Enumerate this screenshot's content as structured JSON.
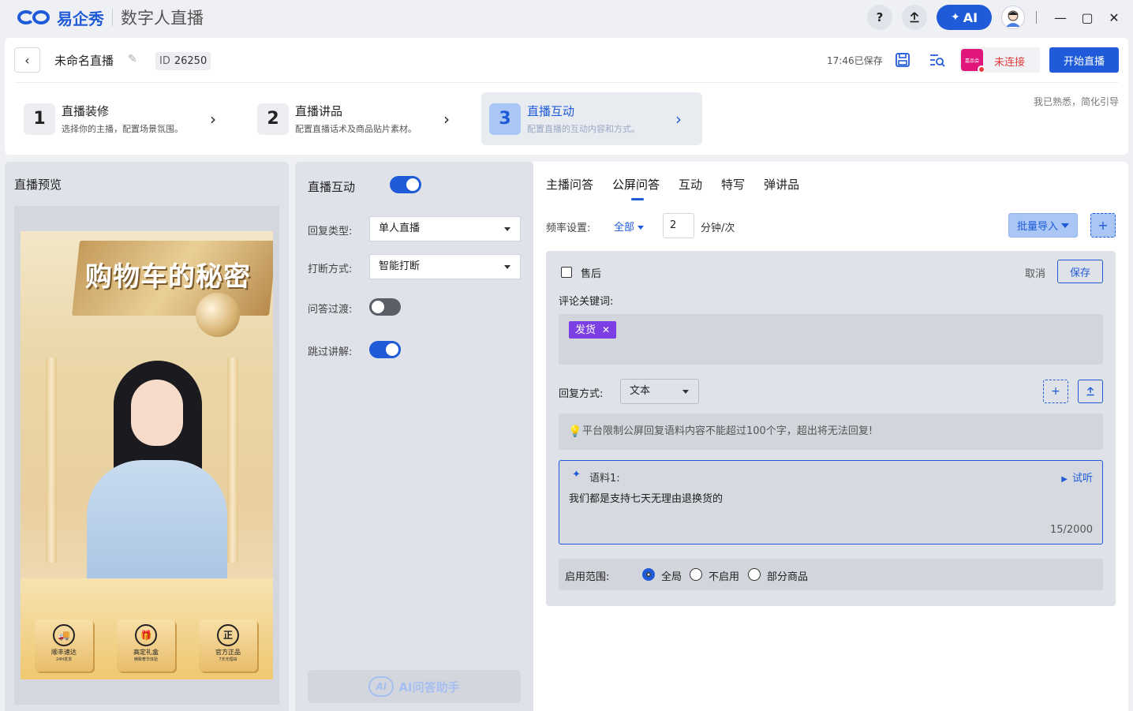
{
  "titlebar": {
    "brand": "易企秀",
    "app_title": "数字人直播",
    "help_label": "?",
    "ai_label": "AI"
  },
  "header": {
    "project_name": "未命名直播",
    "id_prefix": "ID",
    "id_value": "26250",
    "saved_text": "17:46已保存",
    "shop_logo_text": "嘉品会",
    "connect_status": "未连接",
    "start_button": "开始直播"
  },
  "steps": [
    {
      "num": "1",
      "title": "直播装修",
      "desc": "选择你的主播，配置场景氛围。"
    },
    {
      "num": "2",
      "title": "直播讲品",
      "desc": "配置直播话术及商品贴片素材。"
    },
    {
      "num": "3",
      "title": "直播互动",
      "desc": "配置直播的互动内容和方式。"
    }
  ],
  "guide_text": "我已熟悉，简化引导",
  "preview": {
    "title": "直播预览",
    "banner": "购物车的秘密",
    "badges": [
      {
        "icon": "🚚",
        "label": "顺丰速达",
        "sub": "24H发货"
      },
      {
        "icon": "🎁",
        "label": "高定礼盒",
        "sub": "精致奢华体验"
      },
      {
        "icon": "正",
        "label": "官方正品",
        "sub": "7天无理由"
      }
    ]
  },
  "settings": {
    "title": "直播互动",
    "enabled": true,
    "reply_type_label": "回复类型:",
    "reply_type_value": "单人直播",
    "interrupt_label": "打断方式:",
    "interrupt_value": "智能打断",
    "transition_label": "问答过渡:",
    "transition_on": false,
    "skip_label": "跳过讲解:",
    "skip_on": true,
    "ai_assist_label": "AI问答助手",
    "ai_logo": "AI"
  },
  "main": {
    "tabs": [
      "主播问答",
      "公屏问答",
      "互动",
      "特写",
      "弹讲品"
    ],
    "active_tab": "公屏问答",
    "freq_label": "频率设置:",
    "freq_scope": "全部",
    "freq_value": "2",
    "freq_unit": "分钟/次",
    "batch_import": "批量导入",
    "qa": {
      "title": "售后",
      "cancel": "取消",
      "save": "保存",
      "keyword_label": "评论关键词:",
      "keywords": [
        "发货"
      ],
      "reply_method_label": "回复方式:",
      "reply_method_value": "文本",
      "tip": "平台限制公屏回复语料内容不能超过100个字，超出将无法回复!",
      "corpus_label": "语料1:",
      "try_label": "试听",
      "corpus_text": "我们都是支持七天无理由退换货的",
      "corpus_count": "15/2000",
      "scope_label": "启用范围:",
      "scope_options": [
        "全局",
        "不启用",
        "部分商品"
      ],
      "scope_selected": "全局"
    }
  }
}
